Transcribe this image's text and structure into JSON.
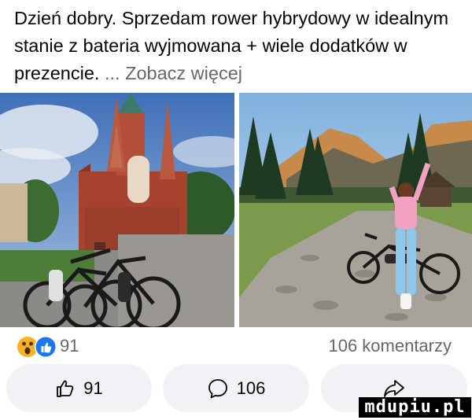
{
  "post": {
    "text": "Dzień dobry. Sprzedam rower hybrydowy w idealnym stanie z bateria wyjmowana + wiele dodatków w prezencie.",
    "see_more": "... Zobacz więcej"
  },
  "photos": [
    {
      "icon": "church-with-bikes-photo"
    },
    {
      "icon": "mountain-trail-with-bike-photo"
    }
  ],
  "stats": {
    "reactions_count": "91",
    "comments_count": "106 komentarzy",
    "reaction_icons": [
      "wow-icon",
      "like-icon"
    ]
  },
  "actions": {
    "like_count": "91",
    "comment_count": "106"
  },
  "watermark": "mdupiu.pl",
  "colors": {
    "secondary_text": "#65676b",
    "pill_bg": "#f0f2f5",
    "like_blue": "#1877f2",
    "wow_yellow": "#f7b125"
  }
}
